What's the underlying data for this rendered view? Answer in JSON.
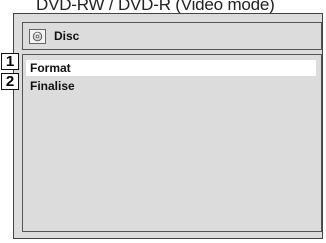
{
  "caption": "DVD-RW / DVD-R (Video mode)",
  "window": {
    "title": "Disc",
    "title_icon": "disc-icon"
  },
  "menu": {
    "items": [
      {
        "label": "Format",
        "selected": true
      },
      {
        "label": "Finalise",
        "selected": false
      }
    ]
  },
  "callouts": [
    "1",
    "2"
  ],
  "colors": {
    "screen_bg": "#dcdcdc",
    "selected_row_bg": "#ffffff",
    "border": "#555555",
    "text": "#111111"
  }
}
